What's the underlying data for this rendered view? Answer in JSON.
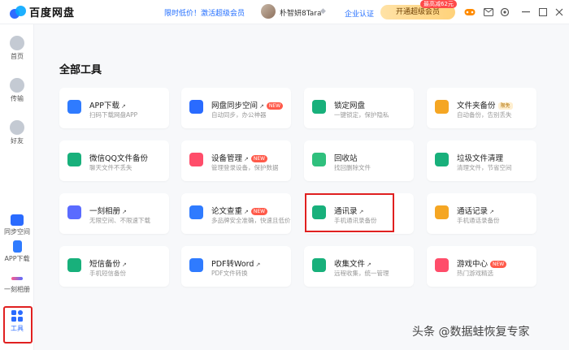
{
  "app": {
    "title": "百度网盘"
  },
  "header": {
    "promo_label": "限时低价！激活超级会员",
    "username": "朴智妍8Tara",
    "verify_label": "企业认证",
    "open_vip_label": "开通超级会员",
    "vip_badge": "最高减62元"
  },
  "sidebar": {
    "items": [
      {
        "label": "首页",
        "icon": "cloud-icon"
      },
      {
        "label": "传输",
        "icon": "transfer-icon"
      },
      {
        "label": "好友",
        "icon": "friends-icon"
      },
      {
        "label": "同步空间",
        "icon": "sync-icon"
      },
      {
        "label": "APP下载",
        "icon": "phone-icon"
      },
      {
        "label": "一刻相册",
        "icon": "album-icon"
      },
      {
        "label": "工具",
        "icon": "tools-icon"
      }
    ]
  },
  "main": {
    "title": "全部工具",
    "tools": [
      {
        "title": "APP下载",
        "subtitle": "扫码下载网盘APP",
        "arrow": true,
        "tag": "",
        "color": "#2f7bff"
      },
      {
        "title": "网盘同步空间",
        "subtitle": "自动同步，办公神器",
        "arrow": true,
        "tag": "NEW",
        "color": "#2a6bff"
      },
      {
        "title": "锁定网盘",
        "subtitle": "一键锁定，保护隐私",
        "arrow": false,
        "tag": "",
        "color": "#18b07b"
      },
      {
        "title": "文件夹备份",
        "subtitle": "自动备份，告别丢失",
        "arrow": false,
        "tag": "限免",
        "color": "#f5a623"
      },
      {
        "title": "微信QQ文件备份",
        "subtitle": "聊天文件不丢失",
        "arrow": false,
        "tag": "",
        "color": "#18b07b"
      },
      {
        "title": "设备管理",
        "subtitle": "管理登录设备，保护数据",
        "arrow": true,
        "tag": "NEW",
        "color": "#ff4d6a"
      },
      {
        "title": "回收站",
        "subtitle": "找回删除文件",
        "arrow": false,
        "tag": "",
        "color": "#2fc07d"
      },
      {
        "title": "垃圾文件清理",
        "subtitle": "清理文件，节省空间",
        "arrow": false,
        "tag": "",
        "color": "#18b07b"
      },
      {
        "title": "一刻相册",
        "subtitle": "无限空间、不限速下载",
        "arrow": true,
        "tag": "",
        "color": "#5a6bff"
      },
      {
        "title": "论文查重",
        "subtitle": "多品牌安全准确，快速且低价",
        "arrow": true,
        "tag": "NEW",
        "color": "#2f7bff"
      },
      {
        "title": "通讯录",
        "subtitle": "手机通讯录备份",
        "arrow": true,
        "tag": "",
        "color": "#18b07b"
      },
      {
        "title": "通话记录",
        "subtitle": "手机通话录备份",
        "arrow": true,
        "tag": "",
        "color": "#f5a623"
      },
      {
        "title": "短信备份",
        "subtitle": "手机短信备份",
        "arrow": true,
        "tag": "",
        "color": "#18b07b"
      },
      {
        "title": "PDF转Word",
        "subtitle": "PDF文件转换",
        "arrow": true,
        "tag": "",
        "color": "#2f7bff"
      },
      {
        "title": "收集文件",
        "subtitle": "远程收集，统一管理",
        "arrow": true,
        "tag": "",
        "color": "#18b07b"
      },
      {
        "title": "游戏中心",
        "subtitle": "热门游戏精选",
        "arrow": false,
        "tag": "NEW",
        "color": "#ff4d6a"
      }
    ]
  },
  "watermark": "头条 @数据蛙恢复专家"
}
